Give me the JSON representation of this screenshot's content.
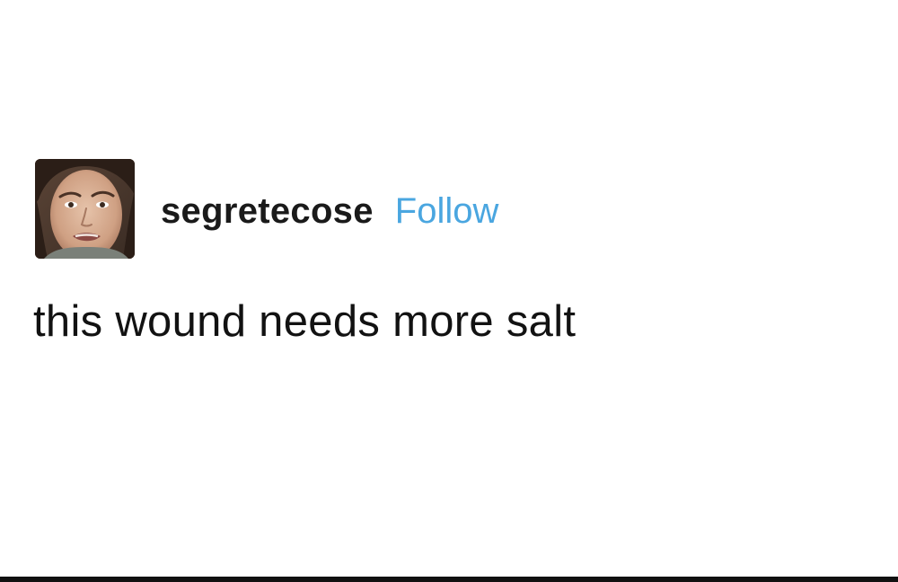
{
  "post": {
    "author": {
      "username": "segretecose",
      "avatar_icon": "user-avatar-photo"
    },
    "follow_label": "Follow",
    "follow_color": "#4aa6e0",
    "text": "this wound needs more salt"
  }
}
